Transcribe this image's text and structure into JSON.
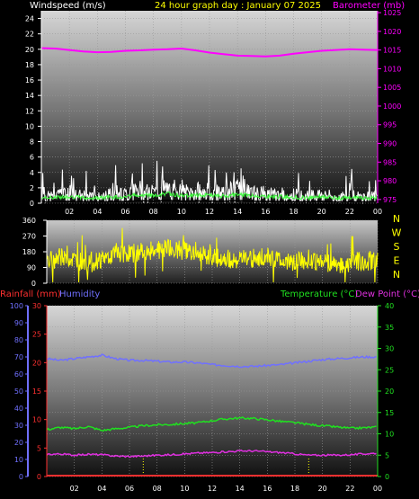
{
  "header": {
    "left_label": "Windspeed (m/s)",
    "center_label": "24 hour graph day : January 07 2025",
    "right_label": "Barometer (mb)"
  },
  "colors": {
    "windspeed": "#ffffff",
    "gust_avg": "#40ff40",
    "barometer": "#ff00ff",
    "direction": "#ffff00",
    "rainfall": "#ff3030",
    "humidity": "#7070ff",
    "temperature": "#20e020",
    "dewpoint": "#e030e0",
    "title": "#ffff00",
    "axis_text": "#ffffff"
  },
  "x_ticks": [
    "02",
    "04",
    "06",
    "08",
    "10",
    "12",
    "14",
    "16",
    "18",
    "20",
    "22",
    "00"
  ],
  "compass": [
    "N",
    "W",
    "S",
    "E",
    "N"
  ],
  "panel3_labels": {
    "rainfall": "Rainfall (mm)",
    "humidity": "Humidity",
    "temperature": "Temperature (°C)",
    "dewpoint": "Dew Point (°C)"
  },
  "chart_data": [
    {
      "type": "line",
      "name": "wind-baro",
      "x_range": [
        0,
        24
      ],
      "y_left": {
        "label": "Windspeed (m/s)",
        "ticks": [
          0,
          2,
          4,
          6,
          8,
          10,
          12,
          14,
          16,
          18,
          20,
          22,
          24
        ],
        "range": [
          0,
          25
        ]
      },
      "y_right": {
        "label": "Barometer (mb)",
        "ticks": [
          975,
          980,
          985,
          990,
          995,
          1000,
          1005,
          1010,
          1015,
          1020,
          1025
        ],
        "range": [
          974,
          1025.5
        ]
      },
      "series": [
        {
          "name": "Windspeed (m/s)",
          "axis": "left",
          "x": [
            0,
            1,
            2,
            3,
            4,
            5,
            6,
            7,
            8,
            9,
            10,
            11,
            12,
            13,
            14,
            15,
            16,
            17,
            18,
            19,
            20,
            21,
            22,
            23,
            24
          ],
          "y": [
            1.0,
            1.3,
            1.5,
            1.2,
            1.0,
            1.4,
            1.5,
            2.2,
            1.8,
            2.5,
            1.8,
            2.0,
            1.9,
            1.7,
            2.3,
            1.8,
            1.6,
            1.5,
            1.4,
            1.2,
            1.6,
            1.0,
            1.3,
            1.1,
            1.2
          ]
        },
        {
          "name": "Barometer (mb)",
          "axis": "right",
          "x": [
            0,
            1,
            2,
            3,
            4,
            5,
            6,
            7,
            8,
            9,
            10,
            11,
            12,
            13,
            14,
            15,
            16,
            17,
            18,
            19,
            20,
            21,
            22,
            23,
            24
          ],
          "y": [
            1015.5,
            1015.4,
            1015,
            1014.6,
            1014.4,
            1014.5,
            1014.8,
            1014.9,
            1015.1,
            1015.2,
            1015.4,
            1014.9,
            1014.3,
            1013.9,
            1013.5,
            1013.4,
            1013.3,
            1013.5,
            1014,
            1014.4,
            1014.8,
            1015,
            1015.2,
            1015.1,
            1015
          ]
        }
      ]
    },
    {
      "type": "line",
      "name": "wind-direction",
      "x_range": [
        0,
        24
      ],
      "y": {
        "ticks": [
          0,
          90,
          180,
          270,
          360
        ],
        "range": [
          0,
          360
        ]
      },
      "series": [
        {
          "name": "Wind direction",
          "x": [
            0,
            1,
            2,
            3,
            4,
            5,
            6,
            7,
            8,
            9,
            10,
            11,
            12,
            13,
            14,
            15,
            16,
            17,
            18,
            19,
            20,
            21,
            22,
            23,
            24
          ],
          "y": [
            120,
            150,
            130,
            110,
            140,
            160,
            170,
            180,
            190,
            200,
            185,
            170,
            150,
            140,
            135,
            145,
            150,
            130,
            125,
            140,
            120,
            110,
            115,
            130,
            120
          ]
        }
      ]
    },
    {
      "type": "line",
      "name": "rain-humidity-temp",
      "x_range": [
        0,
        24
      ],
      "y_left_outer": {
        "label": "Humidity",
        "ticks": [
          0,
          10,
          20,
          30,
          40,
          50,
          60,
          70,
          80,
          90,
          100
        ],
        "range": [
          0,
          100
        ]
      },
      "y_left_inner": {
        "label": "Rainfall (mm)",
        "ticks": [
          0,
          5,
          10,
          15,
          20,
          25,
          30
        ],
        "range": [
          0,
          30
        ]
      },
      "y_right": {
        "label": "Temperature (°C)",
        "ticks": [
          0,
          5,
          10,
          15,
          20,
          25,
          30,
          35,
          40
        ],
        "range": [
          0,
          40
        ]
      },
      "series": [
        {
          "name": "Humidity",
          "axis": "outer",
          "x": [
            0,
            1,
            2,
            3,
            4,
            5,
            6,
            7,
            8,
            9,
            10,
            11,
            12,
            13,
            14,
            15,
            16,
            17,
            18,
            19,
            20,
            21,
            22,
            23,
            24
          ],
          "y": [
            69,
            68,
            69,
            70,
            71,
            69,
            68,
            68,
            67.5,
            67,
            67,
            66.5,
            65.5,
            65,
            64.5,
            64.5,
            65,
            65.5,
            66.5,
            67.5,
            68.5,
            69,
            69.5,
            70,
            70
          ]
        },
        {
          "name": "Temperature (°C)",
          "axis": "right",
          "x": [
            0,
            1,
            2,
            3,
            4,
            5,
            6,
            7,
            8,
            9,
            10,
            11,
            12,
            13,
            14,
            15,
            16,
            17,
            18,
            19,
            20,
            21,
            22,
            23,
            24
          ],
          "y": [
            11,
            11.5,
            11.2,
            11.7,
            10.8,
            11.2,
            11.5,
            11.9,
            12.1,
            12.2,
            12.4,
            12.6,
            13.1,
            13.5,
            13.7,
            13.6,
            13.3,
            12.9,
            12.6,
            12.2,
            11.9,
            11.6,
            11.3,
            11.4,
            11.6
          ]
        },
        {
          "name": "Dew Point (°C)",
          "axis": "right",
          "x": [
            0,
            1,
            2,
            3,
            4,
            5,
            6,
            7,
            8,
            9,
            10,
            11,
            12,
            13,
            14,
            15,
            16,
            17,
            18,
            19,
            20,
            21,
            22,
            23,
            24
          ],
          "y": [
            5.2,
            5.3,
            5.0,
            5.2,
            5.1,
            4.8,
            4.7,
            4.8,
            5,
            5.1,
            5.3,
            5.5,
            5.6,
            5.8,
            6,
            6,
            5.8,
            5.6,
            5.3,
            5,
            5,
            5,
            5.1,
            5.3,
            5.5
          ]
        },
        {
          "name": "Rainfall (mm)",
          "axis": "inner",
          "x": [
            0,
            24
          ],
          "y": [
            0,
            0
          ]
        }
      ]
    }
  ]
}
